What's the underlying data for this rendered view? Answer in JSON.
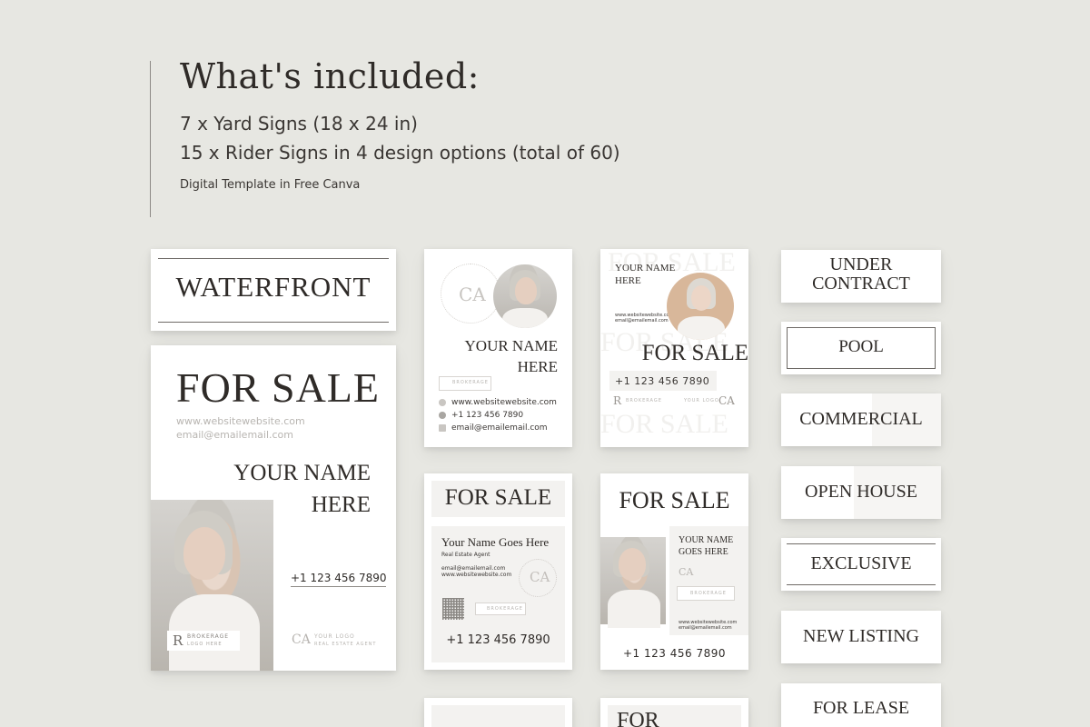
{
  "header": {
    "title": "What's included:",
    "line1": "7 x Yard Signs (18 x 24 in)",
    "line2": "15 x Rider Signs in 4 design options (total of 60)",
    "line3": "Digital Template in Free Canva"
  },
  "waterfront": {
    "label": "WATERFRONT"
  },
  "main_sign": {
    "headline": "FOR SALE",
    "website": "www.websitewebsite.com",
    "email": "email@emailemail.com",
    "name_line1": "YOUR NAME",
    "name_line2": "HERE",
    "phone": "+1 123 456 7890",
    "brokerage": "BROKERAGE",
    "brokerage_sub": "LOGO HERE",
    "logo_mono": "CA",
    "logo_line1": "YOUR LOGO",
    "logo_line2": "REAL ESTATE AGENT"
  },
  "card2": {
    "logo_mono": "CA",
    "name_line1": "YOUR NAME",
    "name_line2": "HERE",
    "brokerage": "BROKERAGE",
    "website": "www.websitewebsite.com",
    "phone": "+1 123 456 7890",
    "email": "email@emailemail.com"
  },
  "card3": {
    "name_line1": "YOUR NAME",
    "name_line2": "HERE",
    "website": "www.websitewebsite.com",
    "email": "email@emailemail.com",
    "headline": "FOR SALE",
    "phone": "+1 123 456 7890",
    "brokerage": "BROKERAGE",
    "logo_mono": "CA",
    "logo_line1": "YOUR LOGO",
    "bg_word": "FOR SALE"
  },
  "card4": {
    "headline": "FOR SALE",
    "name": "Your Name Goes Here",
    "role": "Real Estate Agent",
    "email": "email@emailemail.com",
    "website": "www.websitewebsite.com",
    "logo_mono": "CA",
    "brokerage": "BROKERAGE",
    "phone": "+1 123 456 7890"
  },
  "card5": {
    "headline": "FOR SALE",
    "name_line1": "YOUR NAME",
    "name_line2": "GOES HERE",
    "logo_mono": "CA",
    "brokerage": "BROKERAGE",
    "website": "www.websitewebsite.com",
    "email": "email@emailemail.com",
    "phone": "+1 123 456 7890"
  },
  "card7": {
    "headline": "FOR"
  },
  "riders": {
    "under_line1": "UNDER",
    "under_line2": "CONTRACT",
    "pool": "POOL",
    "commercial": "COMMERCIAL",
    "open_house": "OPEN HOUSE",
    "exclusive": "EXCLUSIVE",
    "new_listing": "NEW LISTING",
    "for_lease": "FOR LEASE"
  }
}
